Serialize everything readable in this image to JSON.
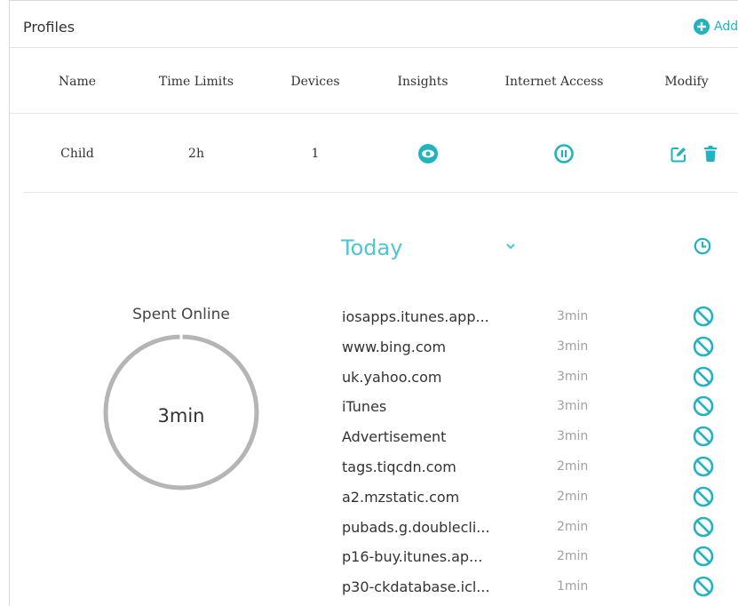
{
  "profiles": {
    "title": "Profiles",
    "add_label": "Add",
    "columns": {
      "name": "Name",
      "time_limits": "Time Limits",
      "devices": "Devices",
      "insights": "Insights",
      "internet_access": "Internet Access",
      "modify": "Modify"
    },
    "rows": [
      {
        "name": "Child",
        "time_limits": "2h",
        "devices": "1"
      }
    ]
  },
  "insights_panel": {
    "period_label": "Today",
    "spent_label": "Spent Online",
    "spent_value": "3min",
    "sites": [
      {
        "name": "iosapps.itunes.app...",
        "time": "3min"
      },
      {
        "name": "www.bing.com",
        "time": "3min"
      },
      {
        "name": "uk.yahoo.com",
        "time": "3min"
      },
      {
        "name": "iTunes",
        "time": "3min"
      },
      {
        "name": "Advertisement",
        "time": "3min"
      },
      {
        "name": "tags.tiqcdn.com",
        "time": "2min"
      },
      {
        "name": "a2.mzstatic.com",
        "time": "2min"
      },
      {
        "name": "pubads.g.doublecli...",
        "time": "2min"
      },
      {
        "name": "p16-buy.itunes.ap...",
        "time": "2min"
      },
      {
        "name": "p30-ckdatabase.icl...",
        "time": "1min"
      }
    ]
  },
  "colors": {
    "accent": "#22b3c1",
    "today_text": "#4fc5cf",
    "ring": "#b5b5b8",
    "muted_text": "#a0a0a0"
  },
  "icons": {
    "add": "plus-circle-icon",
    "insights": "eye-icon",
    "internet_access": "pause-icon",
    "edit": "edit-icon",
    "delete": "trash-icon",
    "period_dropdown": "chevron-down-icon",
    "history": "clock-icon",
    "block": "block-icon"
  }
}
